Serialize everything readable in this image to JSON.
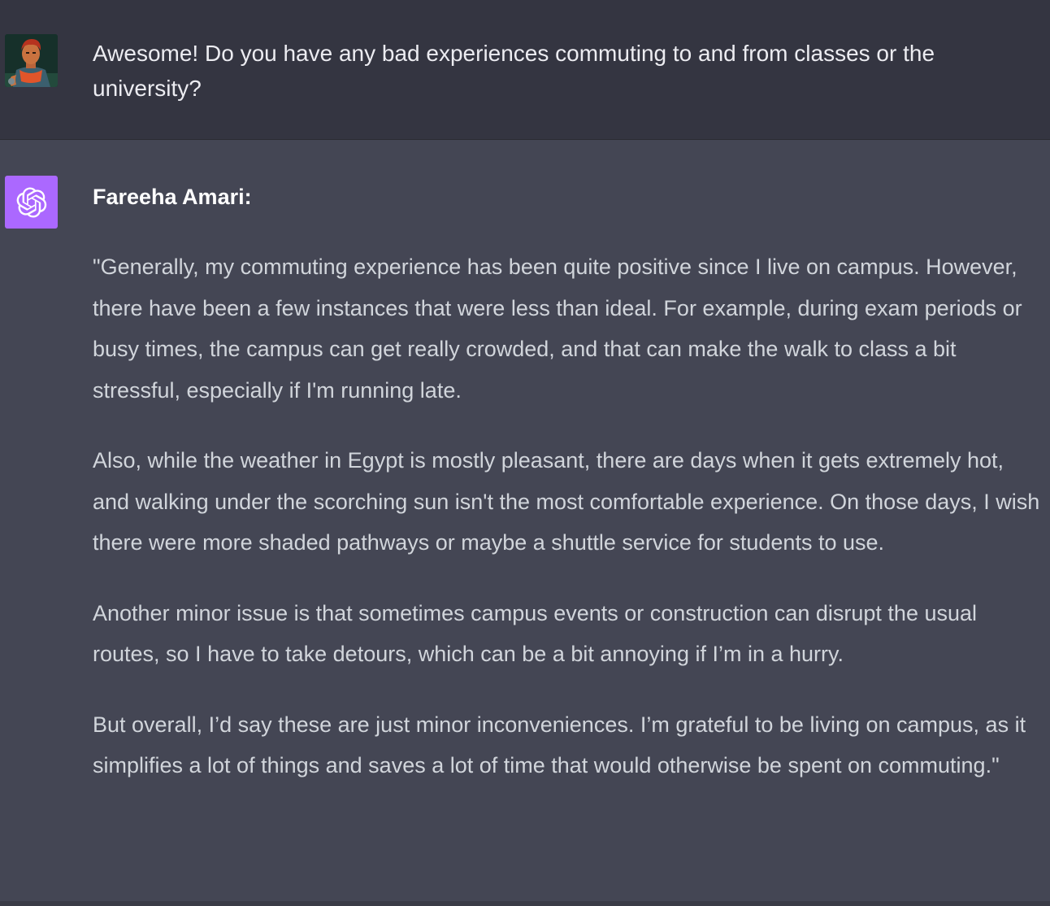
{
  "user_message": {
    "text": "Awesome! Do you have any bad experiences commuting to and from classes or the university?"
  },
  "assistant_message": {
    "name": "Fareeha Amari:",
    "paragraphs": [
      "\"Generally, my commuting experience has been quite positive since I live on campus. However, there have been a few instances that were less than ideal. For example, during exam periods or busy times, the campus can get really crowded, and that can make the walk to class a bit stressful, especially if I'm running late.",
      "Also, while the weather in Egypt is mostly pleasant, there are days when it gets extremely hot, and walking under the scorching sun isn't the most comfortable experience. On those days, I wish there were more shaded pathways or maybe a shuttle service for students to use.",
      "Another minor issue is that sometimes campus events or construction can disrupt the usual routes, so I have to take detours, which can be a bit annoying if I’m in a hurry.",
      "But overall, I’d say these are just minor inconveniences. I’m grateful to be living on campus, as it simplifies a lot of things and saves a lot of time that would otherwise be spent on commuting.\""
    ]
  },
  "icons": {
    "user_avatar": "user-avatar-icon",
    "assistant_avatar": "openai-logo-icon"
  },
  "colors": {
    "user_row_bg": "#343541",
    "assistant_row_bg": "#444654",
    "assistant_avatar_bg": "#ab68ff",
    "text": "#d1d5db"
  }
}
